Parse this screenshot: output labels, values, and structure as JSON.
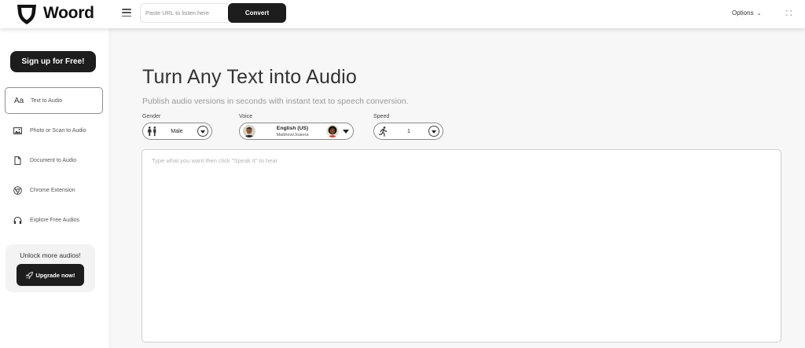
{
  "brand": {
    "name": "Woord"
  },
  "header": {
    "url_placeholder": "Paste URL to listen here",
    "convert_label": "Convert",
    "options_label": "Options",
    "options_caret": "⌄"
  },
  "sidebar": {
    "signup_label": "Sign up for Free!",
    "items": [
      {
        "label": "Text to Audio",
        "icon": "text-aa-icon",
        "glyph": "Aa",
        "active": true
      },
      {
        "label": "Photo or Scan to Audio",
        "icon": "image-icon",
        "active": false
      },
      {
        "label": "Document to Audio",
        "icon": "document-icon",
        "active": false
      },
      {
        "label": "Chrome Extension",
        "icon": "chrome-icon",
        "active": false
      },
      {
        "label": "Explore Free Audios",
        "icon": "headphones-icon",
        "active": false
      }
    ],
    "unlock_text": "Unlock more audios!",
    "upgrade_label": "Upgrade now!"
  },
  "main": {
    "title": "Turn Any Text into Audio",
    "subtitle": "Publish audio versions in seconds with instant text to speech conversion.",
    "gender": {
      "label": "Gender",
      "value": "Male"
    },
    "voice": {
      "label": "Voice",
      "language": "English (US)",
      "names": "Matthew/Joanna"
    },
    "speed": {
      "label": "Speed",
      "value": "1"
    },
    "textarea_placeholder": "Type what you want then click \"Speak It\" to hear"
  },
  "colors": {
    "dark_button": "#1d1d1d",
    "main_background": "#f7f7f7",
    "subtitle_gray": "#9a9a9a"
  }
}
